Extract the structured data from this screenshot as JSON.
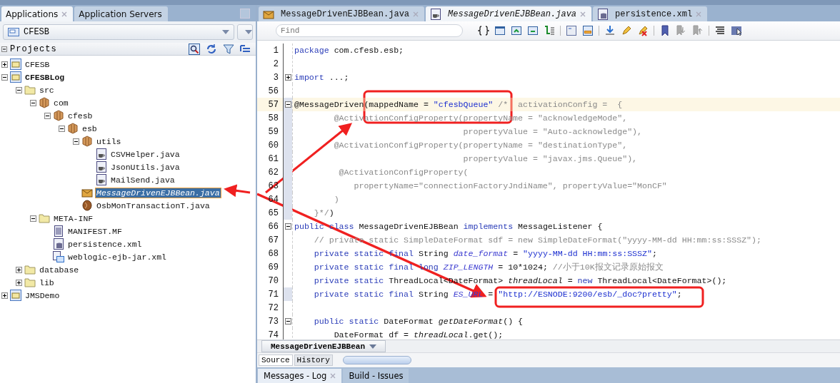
{
  "left_panel": {
    "tabs": [
      {
        "label": "Applications",
        "selected": true,
        "closable": true
      },
      {
        "label": "Application Servers",
        "selected": false,
        "closable": false
      }
    ],
    "project_selector": {
      "value": "CFESB"
    },
    "projects_header": {
      "title": "Projects",
      "expanded": true
    },
    "tree": [
      {
        "label": "CFESB",
        "kind": "project",
        "current": false,
        "expanded": false,
        "selected": false
      },
      {
        "label": "CFESBLog",
        "kind": "project",
        "current": true,
        "expanded": true,
        "selected": false,
        "children": [
          {
            "label": "src",
            "kind": "folder",
            "expanded": true,
            "selected": false,
            "children": [
              {
                "label": "com",
                "kind": "package",
                "expanded": true,
                "selected": false,
                "children": [
                  {
                    "label": "cfesb",
                    "kind": "package",
                    "expanded": true,
                    "selected": false,
                    "children": [
                      {
                        "label": "esb",
                        "kind": "package",
                        "expanded": true,
                        "selected": false,
                        "children": [
                          {
                            "label": "utils",
                            "kind": "package",
                            "expanded": true,
                            "selected": false,
                            "children": [
                              {
                                "label": "CSVHelper.java",
                                "kind": "java",
                                "selected": false
                              },
                              {
                                "label": "JsonUtils.java",
                                "kind": "java",
                                "selected": false
                              },
                              {
                                "label": "MailSend.java",
                                "kind": "java",
                                "selected": false
                              }
                            ]
                          },
                          {
                            "label": "MessageDrivenEJBBean.java",
                            "kind": "ejb",
                            "selected": true
                          },
                          {
                            "label": "OsbMonTransactionT.java",
                            "kind": "bean",
                            "selected": false
                          }
                        ]
                      }
                    ]
                  }
                ]
              },
              {
                "label": "META-INF",
                "kind": "folder",
                "expanded": true,
                "selected": false,
                "children": [
                  {
                    "label": "MANIFEST.MF",
                    "kind": "text",
                    "selected": false
                  },
                  {
                    "label": "persistence.xml",
                    "kind": "db",
                    "selected": false
                  },
                  {
                    "label": "weblogic-ejb-jar.xml",
                    "kind": "xml",
                    "selected": false
                  }
                ]
              }
            ]
          },
          {
            "label": "database",
            "kind": "folder",
            "expanded": false,
            "selected": false
          },
          {
            "label": "lib",
            "kind": "folder",
            "expanded": false,
            "selected": false
          }
        ]
      },
      {
        "label": "JMSDemo",
        "kind": "project",
        "current": false,
        "expanded": false,
        "selected": false
      }
    ]
  },
  "editor": {
    "tabs": [
      {
        "label": "MessageDrivenEJBBean.java",
        "kind": "ejb",
        "selected": false,
        "closable": true
      },
      {
        "label": "MessageDrivenEJBBean.java",
        "kind": "java",
        "selected": true,
        "closable": true
      },
      {
        "label": "persistence.xml",
        "kind": "db",
        "selected": false,
        "closable": true
      }
    ],
    "search": {
      "placeholder": "Find"
    },
    "lines": [
      {
        "number": "1",
        "marked": false,
        "highlighted": false,
        "segments": [
          {
            "kind": "keyword",
            "text": "package"
          },
          {
            "kind": "text",
            "text": " com.cfesb.esb;"
          }
        ]
      },
      {
        "number": "2",
        "marked": false,
        "highlighted": false
      },
      {
        "number": "3",
        "expanded": false,
        "marked": false,
        "highlighted": false,
        "segments": [
          {
            "kind": "keyword",
            "text": "import"
          },
          {
            "kind": "text",
            "text": " ...;"
          }
        ]
      },
      {
        "number": "56",
        "marked": false,
        "highlighted": false
      },
      {
        "number": "57",
        "expanded": true,
        "marked": true,
        "highlighted": true,
        "segments": [
          {
            "kind": "text",
            "text": "@MessageDriven(mappedName = "
          },
          {
            "kind": "string",
            "text": "\"cfesbQueue\""
          },
          {
            "kind": "comment",
            "text": " /*  activationConfig =  {"
          }
        ]
      },
      {
        "number": "58",
        "marked": true,
        "highlighted": false,
        "segments": [
          {
            "kind": "comment",
            "text": "        @ActivationConfigProperty(propertyName = \"acknowledgeMode\","
          }
        ]
      },
      {
        "number": "59",
        "marked": true,
        "highlighted": false,
        "segments": [
          {
            "kind": "comment",
            "text": "                                  propertyValue = \"Auto-acknowledge\"),"
          }
        ]
      },
      {
        "number": "60",
        "marked": true,
        "highlighted": false,
        "segments": [
          {
            "kind": "comment",
            "text": "        @ActivationConfigProperty(propertyName = \"destinationType\","
          }
        ]
      },
      {
        "number": "61",
        "marked": true,
        "highlighted": false,
        "segments": [
          {
            "kind": "comment",
            "text": "                                  propertyValue = \"javax.jms.Queue\"),"
          }
        ]
      },
      {
        "number": "62",
        "marked": true,
        "highlighted": false,
        "segments": [
          {
            "kind": "comment",
            "text": "         @ActivationConfigProperty("
          }
        ]
      },
      {
        "number": "63",
        "marked": true,
        "highlighted": false,
        "segments": [
          {
            "kind": "comment",
            "text": "            propertyName=\"connectionFactoryJndiName\", propertyValue=\"MonCF\""
          }
        ]
      },
      {
        "number": "64",
        "marked": true,
        "highlighted": false,
        "segments": [
          {
            "kind": "comment",
            "text": "        )"
          }
        ]
      },
      {
        "number": "65",
        "marked": true,
        "highlighted": false,
        "segments": [
          {
            "kind": "comment",
            "text": "    }*/"
          },
          {
            "kind": "text",
            "text": ")"
          }
        ]
      },
      {
        "number": "66",
        "expanded": true,
        "marked": false,
        "highlighted": false,
        "segments": [
          {
            "kind": "keyword",
            "text": "public class"
          },
          {
            "kind": "text",
            "text": " MessageDrivenEJBBean "
          },
          {
            "kind": "keyword",
            "text": "implements"
          },
          {
            "kind": "text",
            "text": " MessageListener {"
          }
        ]
      },
      {
        "number": "67",
        "marked": false,
        "highlighted": false,
        "segments": [
          {
            "kind": "comment",
            "text": "    // private static SimpleDateFormat sdf = new SimpleDateFormat(\"yyyy-MM-dd HH:mm:ss:SSSZ\");"
          }
        ]
      },
      {
        "number": "68",
        "marked": false,
        "highlighted": false,
        "segments": [
          {
            "kind": "keyword",
            "text": "    private static final"
          },
          {
            "kind": "text",
            "text": " String "
          },
          {
            "kind": "field",
            "text": "date_format"
          },
          {
            "kind": "text",
            "text": " = "
          },
          {
            "kind": "string",
            "text": "\"yyyy-MM-dd HH:mm:ss:SSSZ\""
          },
          {
            "kind": "text",
            "text": ";"
          }
        ]
      },
      {
        "number": "69",
        "marked": false,
        "highlighted": false,
        "segments": [
          {
            "kind": "keyword",
            "text": "    private static final long "
          },
          {
            "kind": "field",
            "text": "ZIP_LENGTH"
          },
          {
            "kind": "text",
            "text": " = 10*1024; "
          },
          {
            "kind": "comment",
            "text": "//小于10K报文记录原始报文"
          }
        ]
      },
      {
        "number": "70",
        "marked": false,
        "highlighted": false,
        "segments": [
          {
            "kind": "keyword",
            "text": "    private static"
          },
          {
            "kind": "text",
            "text": " ThreadLocal<DateFormat> "
          },
          {
            "kind": "italic",
            "text": "threadLocal"
          },
          {
            "kind": "text",
            "text": " = "
          },
          {
            "kind": "keyword",
            "text": "new"
          },
          {
            "kind": "text",
            "text": " ThreadLocal<DateFormat>();"
          }
        ]
      },
      {
        "number": "71",
        "marked": true,
        "highlighted": false,
        "segments": [
          {
            "kind": "keyword",
            "text": "    private static final"
          },
          {
            "kind": "text",
            "text": " String "
          },
          {
            "kind": "field",
            "text": "ES_URL"
          },
          {
            "kind": "text",
            "text": " = "
          },
          {
            "kind": "string",
            "text": "\"http://ESNODE:9200/esb/_doc?pretty\""
          },
          {
            "kind": "text",
            "text": ";"
          }
        ]
      },
      {
        "number": "72",
        "marked": false,
        "highlighted": false
      },
      {
        "number": "73",
        "expanded": true,
        "marked": false,
        "highlighted": false,
        "segments": [
          {
            "kind": "keyword",
            "text": "    public static"
          },
          {
            "kind": "text",
            "text": " DateFormat "
          },
          {
            "kind": "italic",
            "text": "getDateFormat"
          },
          {
            "kind": "text",
            "text": "() {"
          }
        ]
      },
      {
        "number": "74",
        "marked": false,
        "highlighted": false,
        "segments": [
          {
            "kind": "text",
            "text": "        DateFormat df = "
          },
          {
            "kind": "italic",
            "text": "threadLocal"
          },
          {
            "kind": "text",
            "text": ".get();"
          }
        ]
      }
    ],
    "breadcrumb": "MessageDrivenEJBBean",
    "view_tabs": [
      {
        "label": "Source",
        "selected": true
      },
      {
        "label": "History",
        "selected": false
      }
    ]
  },
  "bottom_tabs": [
    {
      "label": "Messages - Log",
      "selected": true,
      "closable": true
    },
    {
      "label": "Build - Issues",
      "selected": false,
      "closable": false
    }
  ]
}
